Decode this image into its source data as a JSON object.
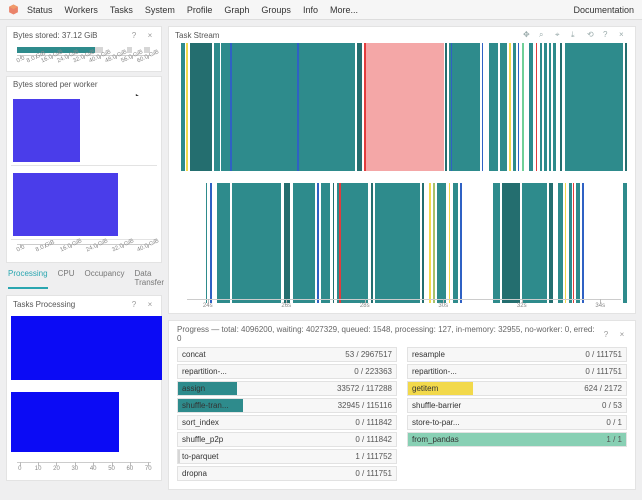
{
  "nav": {
    "items": [
      "Status",
      "Workers",
      "Tasks",
      "System",
      "Profile",
      "Graph",
      "Groups",
      "Info",
      "More..."
    ],
    "active": "Status",
    "doc": "Documentation"
  },
  "bytes_stored": {
    "title": "Bytes stored: 37.12 GiB",
    "ticks": [
      "0.0",
      "8.0 GiB",
      "16.0 GiB",
      "24.0 GiB",
      "32.0 GiB",
      "40.0 GiB",
      "48.0 GiB",
      "56.0 GiB",
      "60.0 GiB"
    ]
  },
  "bytes_per_worker": {
    "title": "Bytes stored per worker",
    "ticks": [
      "0.0",
      "8.0 GiB",
      "16.0 GiB",
      "24.0 GiB",
      "32.0 GiB",
      "40.0 GiB"
    ],
    "bars": [
      0.46,
      0.72
    ]
  },
  "tabs": [
    "Processing",
    "CPU",
    "Occupancy",
    "Data Transfer"
  ],
  "tasks_processing": {
    "title": "Tasks Processing",
    "ticks": [
      "0",
      "10",
      "20",
      "30",
      "40",
      "50",
      "60",
      "70"
    ],
    "bars": [
      {
        "top": 4,
        "h": 64,
        "w": 0.98
      },
      {
        "top": 80,
        "h": 60,
        "w": 0.7
      }
    ]
  },
  "task_stream": {
    "title": "Task Stream",
    "xticks": [
      "24s",
      "26s",
      "28s",
      "30s",
      "32s",
      "34s"
    ]
  },
  "progress": {
    "summary": "Progress — total: 4096200, waiting: 4027329, queued: 1548, processing: 127, in-memory: 32955, no-worker: 0, erred: 0",
    "left": [
      {
        "name": "concat",
        "val": "53 / 2967517",
        "fill": 0,
        "color": "c-gray"
      },
      {
        "name": "repartition-...",
        "val": "0 / 223363",
        "fill": 0,
        "color": "c-gray"
      },
      {
        "name": "assign",
        "val": "33572 / 117288",
        "fill": 0.27,
        "color": "c-teal"
      },
      {
        "name": "shuffle-tran...",
        "val": "32945 / 115116",
        "fill": 0.3,
        "color": "c-teal"
      },
      {
        "name": "sort_index",
        "val": "0 / 111842",
        "fill": 0,
        "color": "c-gray"
      },
      {
        "name": "shuffle_p2p",
        "val": "0 / 111842",
        "fill": 0,
        "color": "c-gray"
      },
      {
        "name": "to-parquet",
        "val": "1 / 111752",
        "fill": 0.01,
        "color": "c-gray"
      },
      {
        "name": "dropna",
        "val": "0 / 111751",
        "fill": 0,
        "color": "c-gray"
      }
    ],
    "right": [
      {
        "name": "resample",
        "val": "0 / 111751",
        "fill": 0,
        "color": "c-gray"
      },
      {
        "name": "repartition-...",
        "val": "0 / 111751",
        "fill": 0,
        "color": "c-gray"
      },
      {
        "name": "getitem",
        "val": "624 / 2172",
        "fill": 0.3,
        "color": "c-yellow"
      },
      {
        "name": "shuffle-barrier",
        "val": "0 / 53",
        "fill": 0,
        "color": "c-gray"
      },
      {
        "name": "store-to-par...",
        "val": "0 / 1",
        "fill": 0,
        "color": "c-gray"
      },
      {
        "name": "from_pandas",
        "val": "1 / 1",
        "fill": 1.0,
        "color": "c-mint"
      }
    ]
  },
  "icons": {
    "help": "?",
    "close": "×",
    "refresh": "↻",
    "zoom": "⌕",
    "pan": "✥",
    "wheel": "⌖",
    "save": "⤓",
    "reset": "⟲"
  },
  "chart_data": {
    "type": "table",
    "note": "Task-stream segment positions/widths are approximate pixel fractions reconstructed from the screenshot; they are rendered below from the stream_segments arrays.",
    "stream_segments_row1": [
      {
        "x": 0.0,
        "w": 0.008,
        "c": "c-teal"
      },
      {
        "x": 0.012,
        "w": 0.004,
        "c": "c-yellow"
      },
      {
        "x": 0.02,
        "w": 0.05,
        "c": "c-tealD"
      },
      {
        "x": 0.075,
        "w": 0.012,
        "c": "c-teal"
      },
      {
        "x": 0.09,
        "w": 0.3,
        "c": "c-teal"
      },
      {
        "x": 0.11,
        "w": 0.004,
        "c": "c-blue"
      },
      {
        "x": 0.26,
        "w": 0.004,
        "c": "c-blue"
      },
      {
        "x": 0.395,
        "w": 0.01,
        "c": "c-tealD"
      },
      {
        "x": 0.41,
        "w": 0.18,
        "c": "c-pink"
      },
      {
        "x": 0.41,
        "w": 0.004,
        "c": "c-red"
      },
      {
        "x": 0.592,
        "w": 0.005,
        "c": "c-tealD"
      },
      {
        "x": 0.6,
        "w": 0.07,
        "c": "c-teal"
      },
      {
        "x": 0.605,
        "w": 0.003,
        "c": "c-blue"
      },
      {
        "x": 0.675,
        "w": 0.003,
        "c": "c-blue"
      },
      {
        "x": 0.69,
        "w": 0.02,
        "c": "c-teal"
      },
      {
        "x": 0.715,
        "w": 0.015,
        "c": "c-teal"
      },
      {
        "x": 0.735,
        "w": 0.005,
        "c": "c-yellow"
      },
      {
        "x": 0.745,
        "w": 0.006,
        "c": "c-teal"
      },
      {
        "x": 0.755,
        "w": 0.003,
        "c": "c-blue"
      },
      {
        "x": 0.765,
        "w": 0.005,
        "c": "c-green"
      },
      {
        "x": 0.78,
        "w": 0.01,
        "c": "c-teal"
      },
      {
        "x": 0.795,
        "w": 0.004,
        "c": "c-red"
      },
      {
        "x": 0.805,
        "w": 0.005,
        "c": "c-teal"
      },
      {
        "x": 0.815,
        "w": 0.005,
        "c": "c-teal"
      },
      {
        "x": 0.825,
        "w": 0.005,
        "c": "c-teal"
      },
      {
        "x": 0.835,
        "w": 0.005,
        "c": "c-teal"
      },
      {
        "x": 0.85,
        "w": 0.004,
        "c": "c-tealD"
      },
      {
        "x": 0.86,
        "w": 0.13,
        "c": "c-teal"
      },
      {
        "x": 0.995,
        "w": 0.005,
        "c": "c-tealD"
      }
    ],
    "stream_segments_row2": [
      {
        "x": 0.055,
        "w": 0.004,
        "c": "c-teal"
      },
      {
        "x": 0.065,
        "w": 0.004,
        "c": "c-blue"
      },
      {
        "x": 0.08,
        "w": 0.03,
        "c": "c-teal"
      },
      {
        "x": 0.115,
        "w": 0.11,
        "c": "c-teal"
      },
      {
        "x": 0.23,
        "w": 0.015,
        "c": "c-tealD"
      },
      {
        "x": 0.25,
        "w": 0.05,
        "c": "c-teal"
      },
      {
        "x": 0.305,
        "w": 0.005,
        "c": "c-blue"
      },
      {
        "x": 0.315,
        "w": 0.02,
        "c": "c-teal"
      },
      {
        "x": 0.34,
        "w": 0.004,
        "c": "c-tealD"
      },
      {
        "x": 0.35,
        "w": 0.07,
        "c": "c-teal"
      },
      {
        "x": 0.355,
        "w": 0.004,
        "c": "c-red"
      },
      {
        "x": 0.425,
        "w": 0.005,
        "c": "c-tealD"
      },
      {
        "x": 0.435,
        "w": 0.1,
        "c": "c-teal"
      },
      {
        "x": 0.54,
        "w": 0.004,
        "c": "c-tealD"
      },
      {
        "x": 0.555,
        "w": 0.005,
        "c": "c-yellow"
      },
      {
        "x": 0.565,
        "w": 0.005,
        "c": "c-olive"
      },
      {
        "x": 0.575,
        "w": 0.02,
        "c": "c-teal"
      },
      {
        "x": 0.6,
        "w": 0.004,
        "c": "c-yellow"
      },
      {
        "x": 0.61,
        "w": 0.01,
        "c": "c-teal"
      },
      {
        "x": 0.625,
        "w": 0.005,
        "c": "c-blue"
      },
      {
        "x": 0.7,
        "w": 0.015,
        "c": "c-teal"
      },
      {
        "x": 0.72,
        "w": 0.04,
        "c": "c-tealD"
      },
      {
        "x": 0.765,
        "w": 0.055,
        "c": "c-teal"
      },
      {
        "x": 0.825,
        "w": 0.008,
        "c": "c-tealD"
      },
      {
        "x": 0.845,
        "w": 0.012,
        "c": "c-teal"
      },
      {
        "x": 0.86,
        "w": 0.004,
        "c": "c-yellow"
      },
      {
        "x": 0.87,
        "w": 0.006,
        "c": "c-teal"
      },
      {
        "x": 0.878,
        "w": 0.004,
        "c": "c-red"
      },
      {
        "x": 0.885,
        "w": 0.01,
        "c": "c-teal"
      },
      {
        "x": 0.9,
        "w": 0.004,
        "c": "c-blue"
      },
      {
        "x": 0.99,
        "w": 0.01,
        "c": "c-teal"
      }
    ]
  }
}
